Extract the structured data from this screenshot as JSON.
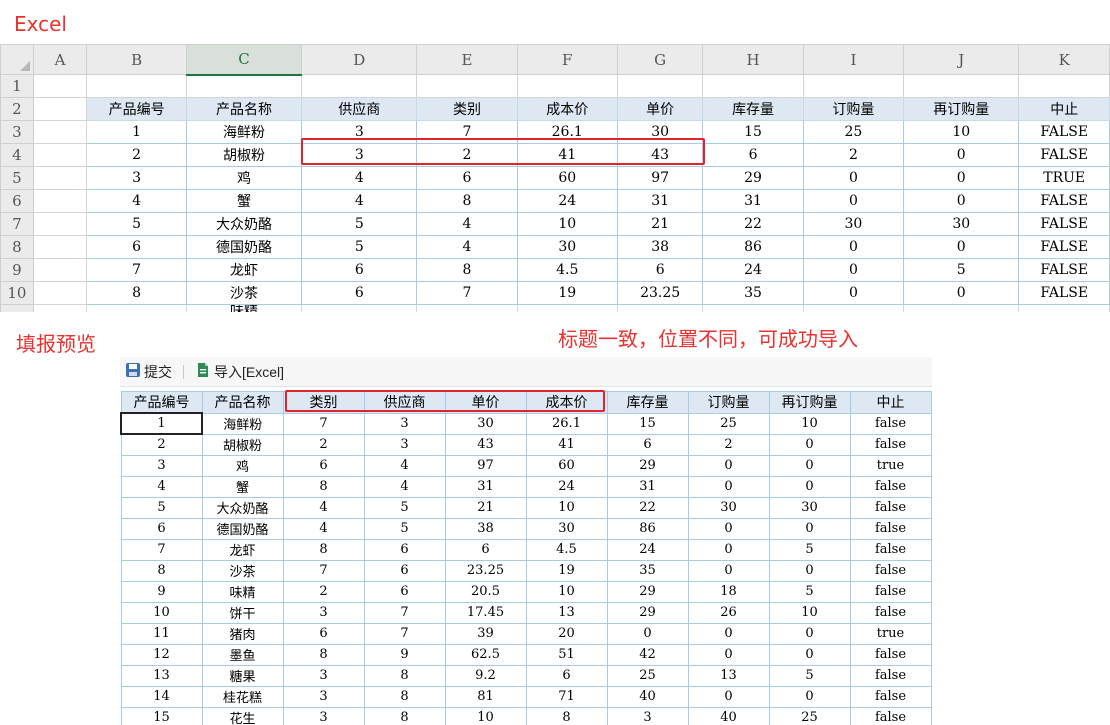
{
  "captions": {
    "excel": "Excel",
    "fill_preview": "填报预览",
    "note": "标题一致，位置不同，可成功导入"
  },
  "excel": {
    "columns": [
      "",
      "A",
      "B",
      "C",
      "D",
      "E",
      "F",
      "G",
      "H",
      "I",
      "J",
      "K"
    ],
    "active_column": "C",
    "row_numbers": [
      "1",
      "2",
      "3",
      "4",
      "5",
      "6",
      "7",
      "8",
      "9",
      "10"
    ],
    "headers": [
      "产品编号",
      "产品名称",
      "供应商",
      "类别",
      "成本价",
      "单价",
      "库存量",
      "订购量",
      "再订购量",
      "中止"
    ],
    "rows": [
      [
        "1",
        "海鲜粉",
        "3",
        "7",
        "26.1",
        "30",
        "15",
        "25",
        "10",
        "FALSE"
      ],
      [
        "2",
        "胡椒粉",
        "3",
        "2",
        "41",
        "43",
        "6",
        "2",
        "0",
        "FALSE"
      ],
      [
        "3",
        "鸡",
        "4",
        "6",
        "60",
        "97",
        "29",
        "0",
        "0",
        "TRUE"
      ],
      [
        "4",
        "蟹",
        "4",
        "8",
        "24",
        "31",
        "31",
        "0",
        "0",
        "FALSE"
      ],
      [
        "5",
        "大众奶酪",
        "5",
        "4",
        "10",
        "21",
        "22",
        "30",
        "30",
        "FALSE"
      ],
      [
        "6",
        "德国奶酪",
        "5",
        "4",
        "30",
        "38",
        "86",
        "0",
        "0",
        "FALSE"
      ],
      [
        "7",
        "龙虾",
        "6",
        "8",
        "4.5",
        "6",
        "24",
        "0",
        "5",
        "FALSE"
      ],
      [
        "8",
        "沙茶",
        "6",
        "7",
        "19",
        "23.25",
        "35",
        "0",
        "0",
        "FALSE"
      ]
    ],
    "partial_row_name": "味精"
  },
  "toolbar": {
    "submit_label": "提交",
    "import_label": "导入[Excel]"
  },
  "report": {
    "headers": [
      "产品编号",
      "产品名称",
      "类别",
      "供应商",
      "单价",
      "成本价",
      "库存量",
      "订购量",
      "再订购量",
      "中止"
    ],
    "rows": [
      [
        "1",
        "海鲜粉",
        "7",
        "3",
        "30",
        "26.1",
        "15",
        "25",
        "10",
        "false"
      ],
      [
        "2",
        "胡椒粉",
        "2",
        "3",
        "43",
        "41",
        "6",
        "2",
        "0",
        "false"
      ],
      [
        "3",
        "鸡",
        "6",
        "4",
        "97",
        "60",
        "29",
        "0",
        "0",
        "true"
      ],
      [
        "4",
        "蟹",
        "8",
        "4",
        "31",
        "24",
        "31",
        "0",
        "0",
        "false"
      ],
      [
        "5",
        "大众奶酪",
        "4",
        "5",
        "21",
        "10",
        "22",
        "30",
        "30",
        "false"
      ],
      [
        "6",
        "德国奶酪",
        "4",
        "5",
        "38",
        "30",
        "86",
        "0",
        "0",
        "false"
      ],
      [
        "7",
        "龙虾",
        "8",
        "6",
        "6",
        "4.5",
        "24",
        "0",
        "5",
        "false"
      ],
      [
        "8",
        "沙茶",
        "7",
        "6",
        "23.25",
        "19",
        "35",
        "0",
        "0",
        "false"
      ],
      [
        "9",
        "味精",
        "2",
        "6",
        "20.5",
        "10",
        "29",
        "18",
        "5",
        "false"
      ],
      [
        "10",
        "饼干",
        "3",
        "7",
        "17.45",
        "13",
        "29",
        "26",
        "10",
        "false"
      ],
      [
        "11",
        "猪肉",
        "6",
        "7",
        "39",
        "20",
        "0",
        "0",
        "0",
        "true"
      ],
      [
        "12",
        "墨鱼",
        "8",
        "9",
        "62.5",
        "51",
        "42",
        "0",
        "0",
        "false"
      ],
      [
        "13",
        "糖果",
        "3",
        "8",
        "9.2",
        "6",
        "25",
        "13",
        "5",
        "false"
      ],
      [
        "14",
        "桂花糕",
        "3",
        "8",
        "81",
        "71",
        "40",
        "0",
        "0",
        "false"
      ],
      [
        "15",
        "花生",
        "3",
        "8",
        "10",
        "8",
        "3",
        "40",
        "25",
        "false"
      ]
    ]
  },
  "colors": {
    "caption_red": "#e8322f",
    "highlight_box": "#e0232c",
    "header_fill": "#dde8f3",
    "grid_line": "#a9cbe3",
    "excel_accent": "#217346"
  },
  "icons": {
    "submit": "save-icon",
    "import": "excel-import-icon"
  }
}
